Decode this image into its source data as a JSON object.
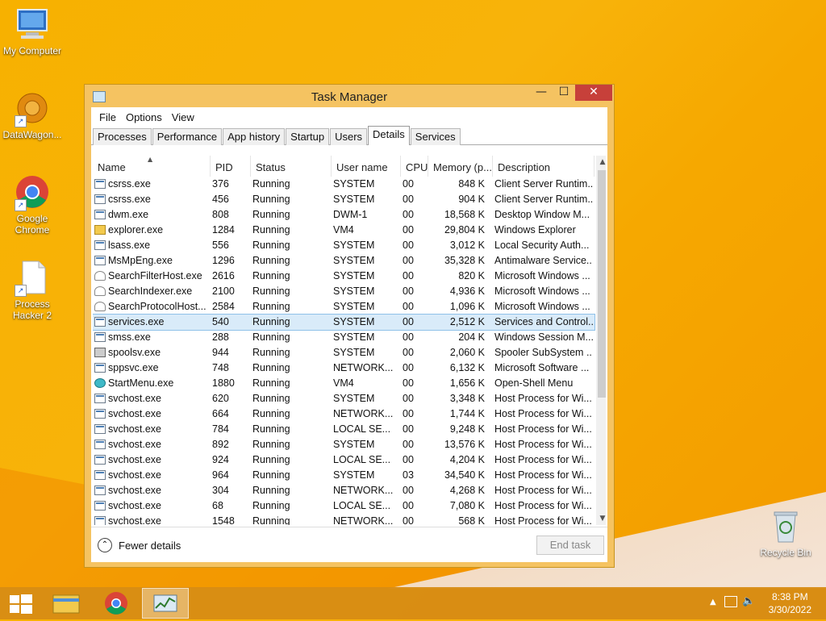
{
  "desktop": {
    "icons": [
      {
        "label": "My Computer",
        "icon": "computer-icon"
      },
      {
        "label": "DataWagon...",
        "icon": "datawagon-icon"
      },
      {
        "label": "Google Chrome",
        "icon": "chrome-icon"
      },
      {
        "label": "Process Hacker 2",
        "icon": "document-icon"
      },
      {
        "label": "Recycle Bin",
        "icon": "recycle-bin-icon"
      }
    ]
  },
  "window": {
    "title": "Task Manager",
    "controls": {
      "minimize": "—",
      "maximize": "☐",
      "close": "✕"
    }
  },
  "menu": [
    "File",
    "Options",
    "View"
  ],
  "tabs": [
    "Processes",
    "Performance",
    "App history",
    "Startup",
    "Users",
    "Details",
    "Services"
  ],
  "active_tab": "Details",
  "columns": [
    "Name",
    "PID",
    "Status",
    "User name",
    "CPU",
    "Memory (p...",
    "Description"
  ],
  "rows": [
    {
      "icon": "exe",
      "name": "csrss.exe",
      "pid": "376",
      "status": "Running",
      "user": "SYSTEM",
      "cpu": "00",
      "mem": "848 K",
      "desc": "Client Server Runtim..."
    },
    {
      "icon": "exe",
      "name": "csrss.exe",
      "pid": "456",
      "status": "Running",
      "user": "SYSTEM",
      "cpu": "00",
      "mem": "904 K",
      "desc": "Client Server Runtim..."
    },
    {
      "icon": "exe",
      "name": "dwm.exe",
      "pid": "808",
      "status": "Running",
      "user": "DWM-1",
      "cpu": "00",
      "mem": "18,568 K",
      "desc": "Desktop Window M..."
    },
    {
      "icon": "folder",
      "name": "explorer.exe",
      "pid": "1284",
      "status": "Running",
      "user": "VM4",
      "cpu": "00",
      "mem": "29,804 K",
      "desc": "Windows Explorer"
    },
    {
      "icon": "exe",
      "name": "lsass.exe",
      "pid": "556",
      "status": "Running",
      "user": "SYSTEM",
      "cpu": "00",
      "mem": "3,012 K",
      "desc": "Local Security Auth..."
    },
    {
      "icon": "exe",
      "name": "MsMpEng.exe",
      "pid": "1296",
      "status": "Running",
      "user": "SYSTEM",
      "cpu": "00",
      "mem": "35,328 K",
      "desc": "Antimalware Service..."
    },
    {
      "icon": "user",
      "name": "SearchFilterHost.exe",
      "pid": "2616",
      "status": "Running",
      "user": "SYSTEM",
      "cpu": "00",
      "mem": "820 K",
      "desc": "Microsoft Windows ..."
    },
    {
      "icon": "user",
      "name": "SearchIndexer.exe",
      "pid": "2100",
      "status": "Running",
      "user": "SYSTEM",
      "cpu": "00",
      "mem": "4,936 K",
      "desc": "Microsoft Windows ..."
    },
    {
      "icon": "user",
      "name": "SearchProtocolHost....",
      "pid": "2584",
      "status": "Running",
      "user": "SYSTEM",
      "cpu": "00",
      "mem": "1,096 K",
      "desc": "Microsoft Windows ..."
    },
    {
      "icon": "exe",
      "name": "services.exe",
      "pid": "540",
      "status": "Running",
      "user": "SYSTEM",
      "cpu": "00",
      "mem": "2,512 K",
      "desc": "Services and Control...",
      "selected": true
    },
    {
      "icon": "exe",
      "name": "smss.exe",
      "pid": "288",
      "status": "Running",
      "user": "SYSTEM",
      "cpu": "00",
      "mem": "204 K",
      "desc": "Windows Session M..."
    },
    {
      "icon": "printer",
      "name": "spoolsv.exe",
      "pid": "944",
      "status": "Running",
      "user": "SYSTEM",
      "cpu": "00",
      "mem": "2,060 K",
      "desc": "Spooler SubSystem ..."
    },
    {
      "icon": "exe",
      "name": "sppsvc.exe",
      "pid": "748",
      "status": "Running",
      "user": "NETWORK...",
      "cpu": "00",
      "mem": "6,132 K",
      "desc": "Microsoft Software ..."
    },
    {
      "icon": "shell",
      "name": "StartMenu.exe",
      "pid": "1880",
      "status": "Running",
      "user": "VM4",
      "cpu": "00",
      "mem": "1,656 K",
      "desc": "Open-Shell Menu"
    },
    {
      "icon": "exe",
      "name": "svchost.exe",
      "pid": "620",
      "status": "Running",
      "user": "SYSTEM",
      "cpu": "00",
      "mem": "3,348 K",
      "desc": "Host Process for Wi..."
    },
    {
      "icon": "exe",
      "name": "svchost.exe",
      "pid": "664",
      "status": "Running",
      "user": "NETWORK...",
      "cpu": "00",
      "mem": "1,744 K",
      "desc": "Host Process for Wi..."
    },
    {
      "icon": "exe",
      "name": "svchost.exe",
      "pid": "784",
      "status": "Running",
      "user": "LOCAL SE...",
      "cpu": "00",
      "mem": "9,248 K",
      "desc": "Host Process for Wi..."
    },
    {
      "icon": "exe",
      "name": "svchost.exe",
      "pid": "892",
      "status": "Running",
      "user": "SYSTEM",
      "cpu": "00",
      "mem": "13,576 K",
      "desc": "Host Process for Wi..."
    },
    {
      "icon": "exe",
      "name": "svchost.exe",
      "pid": "924",
      "status": "Running",
      "user": "LOCAL SE...",
      "cpu": "00",
      "mem": "4,204 K",
      "desc": "Host Process for Wi..."
    },
    {
      "icon": "exe",
      "name": "svchost.exe",
      "pid": "964",
      "status": "Running",
      "user": "SYSTEM",
      "cpu": "03",
      "mem": "34,540 K",
      "desc": "Host Process for Wi..."
    },
    {
      "icon": "exe",
      "name": "svchost.exe",
      "pid": "304",
      "status": "Running",
      "user": "NETWORK...",
      "cpu": "00",
      "mem": "4,268 K",
      "desc": "Host Process for Wi..."
    },
    {
      "icon": "exe",
      "name": "svchost.exe",
      "pid": "68",
      "status": "Running",
      "user": "LOCAL SE...",
      "cpu": "00",
      "mem": "7,080 K",
      "desc": "Host Process for Wi..."
    },
    {
      "icon": "exe",
      "name": "svchost.exe",
      "pid": "1548",
      "status": "Running",
      "user": "NETWORK...",
      "cpu": "00",
      "mem": "568 K",
      "desc": "Host Process for Wi..."
    }
  ],
  "footer": {
    "fewer_details": "Fewer details",
    "end_task": "End task"
  },
  "taskbar": {
    "clock_time": "8:38 PM",
    "clock_date": "3/30/2022"
  },
  "colors": {
    "accent": "#f5c361",
    "close": "#c7403a",
    "selection": "#d9ebf9"
  }
}
